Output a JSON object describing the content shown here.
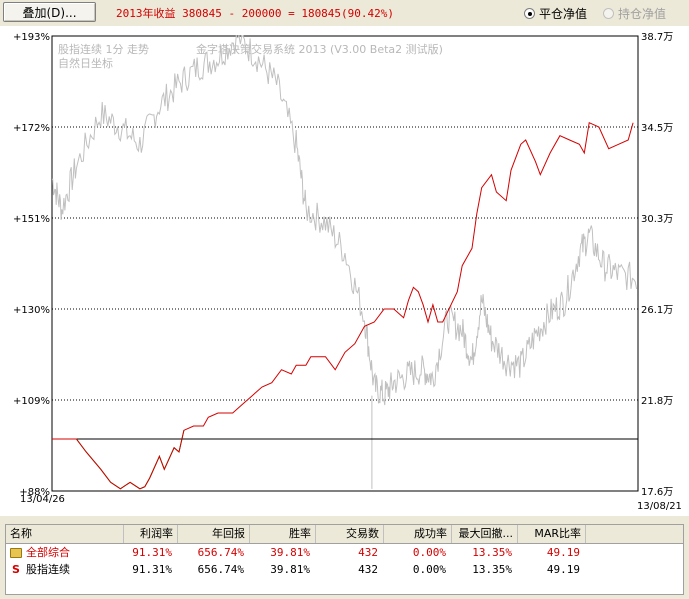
{
  "toolbar": {
    "overlay_button": "叠加(D)...",
    "income_text": "2013年收益 380845 - 200000 = 180845(90.42%)",
    "radio_flat": "平仓净值",
    "radio_hold": "持仓净值"
  },
  "chart": {
    "watermark_line1": "股指连续 1分 走势",
    "watermark_line2": "自然日坐标",
    "watermark_system": "金字塔决策交易系统 2013 (V3.00 Beta2 测试版)",
    "date_start": "13/04/26",
    "date_end": "13/08/21"
  },
  "chart_data": {
    "type": "line",
    "left_axis": {
      "ticks": [
        "+193%",
        "+172%",
        "+151%",
        "+130%",
        "+109%",
        "+88%"
      ],
      "values": [
        193,
        172,
        151,
        130,
        109,
        88
      ],
      "range": [
        88,
        193
      ]
    },
    "right_axis": {
      "ticks": [
        "38.7万",
        "34.5万",
        "30.3万",
        "26.1万",
        "21.8万",
        "17.6万"
      ],
      "range": [
        17.6,
        38.7
      ]
    },
    "x_range": [
      "13/04/26",
      "13/08/21"
    ],
    "grid": "dotted horizontal",
    "baseline_pct": 100,
    "series": [
      {
        "name": "平仓净值",
        "color": "#d40000",
        "color_below_baseline": "#008000",
        "points_pct": [
          [
            0.0,
            100
          ],
          [
            0.05,
            100
          ],
          [
            0.07,
            97
          ],
          [
            0.1,
            93
          ],
          [
            0.12,
            90
          ],
          [
            0.14,
            88.5
          ],
          [
            0.16,
            90
          ],
          [
            0.18,
            88.5
          ],
          [
            0.19,
            89
          ],
          [
            0.2,
            91
          ],
          [
            0.22,
            96
          ],
          [
            0.23,
            93
          ],
          [
            0.25,
            98
          ],
          [
            0.26,
            97
          ],
          [
            0.27,
            102
          ],
          [
            0.29,
            103
          ],
          [
            0.31,
            103
          ],
          [
            0.32,
            105
          ],
          [
            0.34,
            106
          ],
          [
            0.37,
            106
          ],
          [
            0.39,
            108
          ],
          [
            0.41,
            110
          ],
          [
            0.43,
            112
          ],
          [
            0.45,
            113
          ],
          [
            0.47,
            116
          ],
          [
            0.49,
            115
          ],
          [
            0.5,
            117
          ],
          [
            0.52,
            117
          ],
          [
            0.53,
            119
          ],
          [
            0.56,
            119
          ],
          [
            0.58,
            116
          ],
          [
            0.6,
            120
          ],
          [
            0.62,
            122
          ],
          [
            0.64,
            126
          ],
          [
            0.66,
            127
          ],
          [
            0.68,
            130
          ],
          [
            0.7,
            130
          ],
          [
            0.72,
            128
          ],
          [
            0.73,
            132
          ],
          [
            0.74,
            135
          ],
          [
            0.75,
            134
          ],
          [
            0.76,
            131
          ],
          [
            0.77,
            127
          ],
          [
            0.78,
            131
          ],
          [
            0.79,
            127
          ],
          [
            0.8,
            127
          ],
          [
            0.83,
            134
          ],
          [
            0.84,
            140
          ],
          [
            0.86,
            144
          ],
          [
            0.87,
            152
          ],
          [
            0.88,
            158
          ],
          [
            0.9,
            161
          ],
          [
            0.91,
            157
          ],
          [
            0.93,
            155
          ],
          [
            0.94,
            162
          ],
          [
            0.96,
            168
          ],
          [
            0.97,
            169
          ],
          [
            0.99,
            164
          ],
          [
            1.0,
            161
          ],
          [
            1.02,
            166
          ],
          [
            1.04,
            170
          ],
          [
            1.06,
            169
          ],
          [
            1.08,
            168
          ],
          [
            1.09,
            166
          ],
          [
            1.1,
            173
          ],
          [
            1.12,
            172
          ],
          [
            1.14,
            167
          ],
          [
            1.16,
            168
          ],
          [
            1.18,
            169
          ],
          [
            1.19,
            173
          ]
        ]
      },
      {
        "name": "股指连续",
        "color": "#b8b8b8",
        "points_price": "gray price trace (approx.)"
      }
    ]
  },
  "table": {
    "columns": [
      "名称",
      "利润率",
      "年回报",
      "胜率",
      "交易数",
      "成功率",
      "最大回撤...",
      "MAR比率"
    ],
    "rows": [
      {
        "icon": "folder-icon",
        "name": "全部综合",
        "profit": "91.31%",
        "annual": "656.74%",
        "win": "39.81%",
        "trades": "432",
        "success": "0.00%",
        "drawdown": "13.35%",
        "mar": "49.19"
      },
      {
        "icon": "s-icon",
        "name": "股指连续",
        "profit": "91.31%",
        "annual": "656.74%",
        "win": "39.81%",
        "trades": "432",
        "success": "0.00%",
        "drawdown": "13.35%",
        "mar": "49.19"
      }
    ]
  }
}
